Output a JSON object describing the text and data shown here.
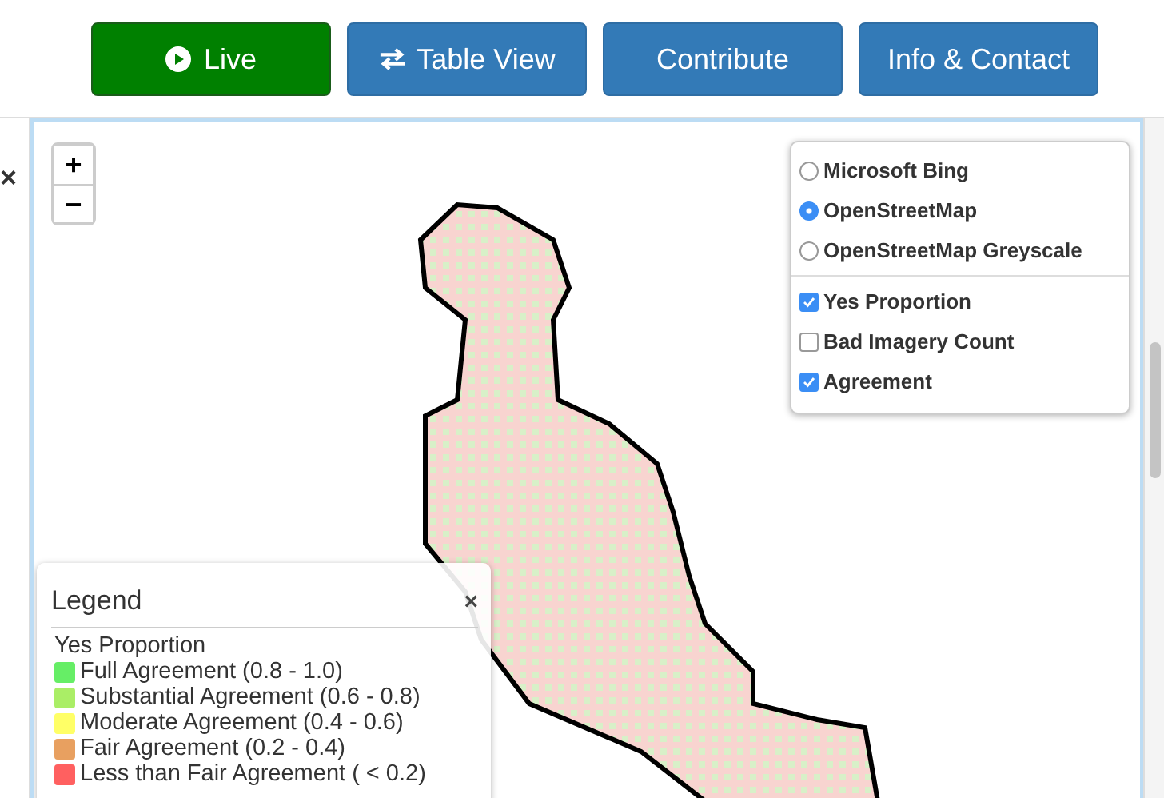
{
  "nav": [
    {
      "label": "Live",
      "kind": "live"
    },
    {
      "label": "Table View",
      "kind": "table"
    },
    {
      "label": "Contribute",
      "kind": "plain"
    },
    {
      "label": "Info & Contact",
      "kind": "plain"
    }
  ],
  "side_panel": {
    "close": "×"
  },
  "map": {
    "zoom": [
      "+",
      "−"
    ],
    "layers": {
      "base": [
        {
          "label": "Microsoft Bing",
          "selected": false
        },
        {
          "label": "OpenStreetMap",
          "selected": true
        },
        {
          "label": "OpenStreetMap Greyscale",
          "selected": false
        }
      ],
      "overlays": [
        {
          "label": "Yes Proportion",
          "checked": true
        },
        {
          "label": "Bad Imagery Count",
          "checked": false
        },
        {
          "label": "Agreement",
          "checked": true
        }
      ]
    },
    "legend": {
      "title": "Legend",
      "close": "×",
      "subtitle": "Yes Proportion",
      "items": [
        {
          "label": "Full Agreement (0.8 - 1.0)",
          "color": "#66ee66"
        },
        {
          "label": "Substantial Agreement (0.6 - 0.8)",
          "color": "#aaee66"
        },
        {
          "label": "Moderate Agreement (0.4 - 0.6)",
          "color": "#ffff66"
        },
        {
          "label": "Fair Agreement (0.2 - 0.4)",
          "color": "#e8a060"
        },
        {
          "label": "Less than Fair Agreement ( < 0.2)",
          "color": "#ff6060"
        }
      ]
    }
  }
}
